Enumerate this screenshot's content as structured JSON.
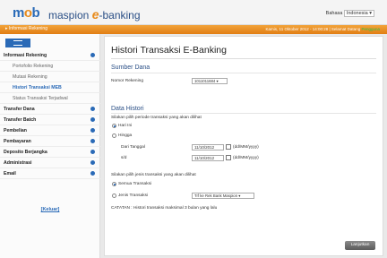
{
  "header": {
    "logo_m": "m",
    "logo_o": "o",
    "logo_b": "b",
    "brand_prefix": "maspion",
    "brand_e": "e",
    "brand_suffix": "-banking",
    "language_label": "Bahasa",
    "language_value": "Indonesia"
  },
  "orangebar": {
    "left_text": "Informasi Rekening",
    "right_text": "Kamis, 11 Oktober 2012 - 14:00:28 | Selamat Datang",
    "right_highlight": "Pengguna"
  },
  "sidebar": {
    "items": [
      {
        "label": "Informasi Rekening",
        "type": "head"
      },
      {
        "label": "Portofolio Rekening",
        "type": "sub"
      },
      {
        "label": "Mutasi Rekening",
        "type": "sub"
      },
      {
        "label": "Histori Transaksi MEB",
        "type": "active"
      },
      {
        "label": "Status Transaksi Terjadwal",
        "type": "sub"
      },
      {
        "label": "Transfer Dana",
        "type": "head"
      },
      {
        "label": "Transfer Batch",
        "type": "head"
      },
      {
        "label": "Pembelian",
        "type": "head"
      },
      {
        "label": "Pembayaran",
        "type": "head"
      },
      {
        "label": "Deposito Berjangka",
        "type": "head"
      },
      {
        "label": "Administrasi",
        "type": "head"
      },
      {
        "label": "Email",
        "type": "head"
      }
    ],
    "logout": "[Keluar]"
  },
  "main": {
    "title": "Histori Transaksi E-Banking",
    "section1": "Sumber Dana",
    "account_label": "Nomor Rekening",
    "account_value": "1011011684",
    "section2": "Data Histori",
    "period_prompt": "Silakan pilih periode transaksi yang akan dilihat",
    "opt_today": "Hari Ini",
    "opt_range": "Hingga",
    "from_label": "Dari Tanggal",
    "from_value": "11/10/2012",
    "to_label": "s/d",
    "to_value": "11/10/2012",
    "date_format": "(dd/MM/yyyy)",
    "type_prompt": "Silakan pilih jenis transaksi yang akan dilihat",
    "opt_all": "Semua Transaksi",
    "opt_type": "Jenis Transaksi",
    "type_value": "Trf ke Rek Bank Maspion",
    "note": "CATATAN : Histori transaksi maksimal 3 bulan yang lalu",
    "continue_button": "Lanjutkan"
  },
  "colors": {
    "brand_blue": "#2a6ab7",
    "accent_orange": "#e88a1a"
  }
}
